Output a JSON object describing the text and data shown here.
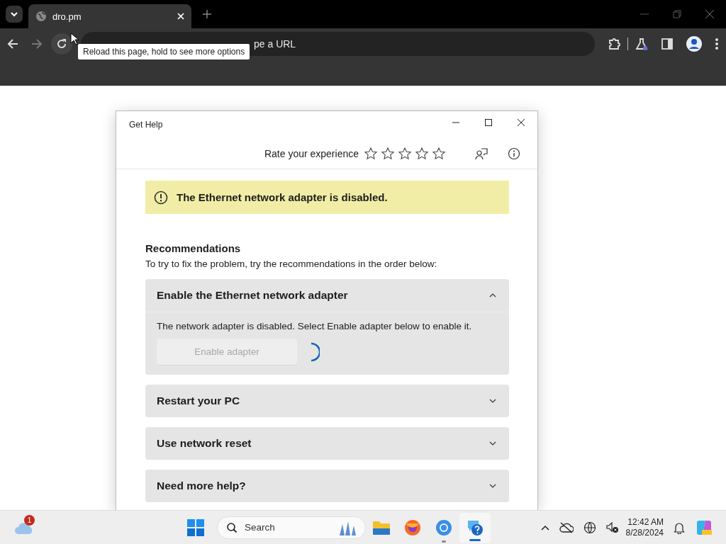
{
  "browser": {
    "tabs": [
      {
        "title": "dro.pm",
        "selected": true
      }
    ],
    "address_text": "pe a URL",
    "tooltip": "Reload this page, hold to see more options"
  },
  "dialog": {
    "title": "Get Help",
    "rating": {
      "label": "Rate your experience",
      "stars": 0
    },
    "alert": "The Ethernet network adapter is disabled.",
    "heading": "Recommendations",
    "intro": "To try to fix the problem, try the recommendations in the order below:",
    "items": [
      {
        "title": "Enable the Ethernet network adapter",
        "expanded": true,
        "description": "The network adapter is disabled. Select Enable adapter below to enable it.",
        "button": {
          "label": "Enable adapter",
          "disabled": true
        },
        "busy": true
      },
      {
        "title": "Restart your PC",
        "expanded": false
      },
      {
        "title": "Use network reset",
        "expanded": false
      },
      {
        "title": "Need more help?",
        "expanded": false
      }
    ]
  },
  "taskbar": {
    "weather_badge": "1",
    "search_placeholder": "Search",
    "apps": [
      {
        "kind": "folder",
        "running": false,
        "selected": false
      },
      {
        "kind": "firefox",
        "running": false,
        "selected": false
      },
      {
        "kind": "chrome",
        "running": true,
        "selected": false
      },
      {
        "kind": "help",
        "running": true,
        "selected": true
      }
    ],
    "time": "12:42 AM",
    "date": "8/28/2024"
  }
}
